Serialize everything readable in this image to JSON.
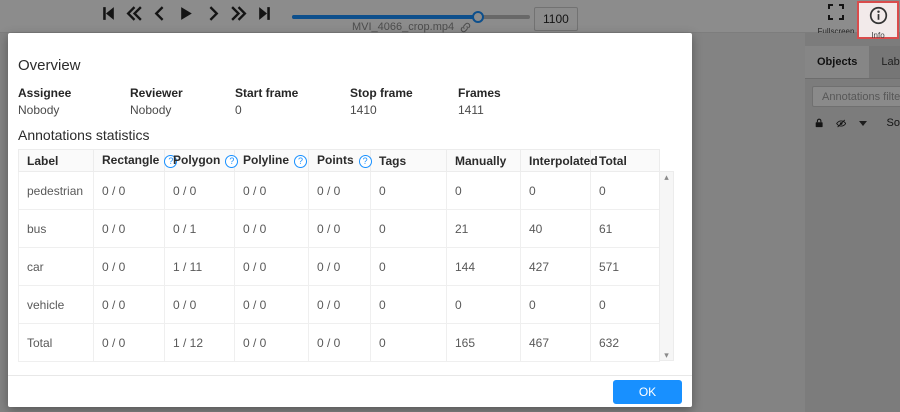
{
  "colors": {
    "accent": "#1890ff",
    "ok_button": "#1890ff",
    "info_highlight": "#d94c4c"
  },
  "player": {
    "filename": "MVI_4066_crop.mp4",
    "frame_value": "1100",
    "slider_percent": 78,
    "controls": [
      "first-frame",
      "backward-jump",
      "previous-frame",
      "play",
      "next-frame",
      "forward-jump",
      "last-frame"
    ]
  },
  "header_right": {
    "fullscreen_label": "Fullscreen",
    "info_label": "Info"
  },
  "sidebar": {
    "tabs": [
      {
        "label": "Objects",
        "active": true
      },
      {
        "label": "Labels",
        "active": false
      }
    ],
    "filter_placeholder": "Annotations filter",
    "sort_label": "So"
  },
  "modal": {
    "overview": {
      "title": "Overview",
      "fields": [
        {
          "label": "Assignee",
          "value": "Nobody"
        },
        {
          "label": "Reviewer",
          "value": "Nobody"
        },
        {
          "label": "Start frame",
          "value": "0"
        },
        {
          "label": "Stop frame",
          "value": "1410"
        },
        {
          "label": "Frames",
          "value": "1411"
        }
      ]
    },
    "statistics": {
      "title": "Annotations statistics",
      "columns": [
        "Label",
        "Rectangle",
        "Polygon",
        "Polyline",
        "Points",
        "Tags",
        "Manually",
        "Interpolated",
        "Total"
      ],
      "help_columns": [
        1,
        2,
        3,
        4
      ],
      "rows": [
        [
          "pedestrian",
          "0 / 0",
          "0 / 0",
          "0 / 0",
          "0 / 0",
          "0",
          "0",
          "0",
          "0"
        ],
        [
          "bus",
          "0 / 0",
          "0 / 1",
          "0 / 0",
          "0 / 0",
          "0",
          "21",
          "40",
          "61"
        ],
        [
          "car",
          "0 / 0",
          "1 / 11",
          "0 / 0",
          "0 / 0",
          "0",
          "144",
          "427",
          "571"
        ],
        [
          "vehicle",
          "0 / 0",
          "0 / 0",
          "0 / 0",
          "0 / 0",
          "0",
          "0",
          "0",
          "0"
        ],
        [
          "Total",
          "0 / 0",
          "1 / 12",
          "0 / 0",
          "0 / 0",
          "0",
          "165",
          "467",
          "632"
        ]
      ]
    },
    "ok_label": "OK"
  }
}
